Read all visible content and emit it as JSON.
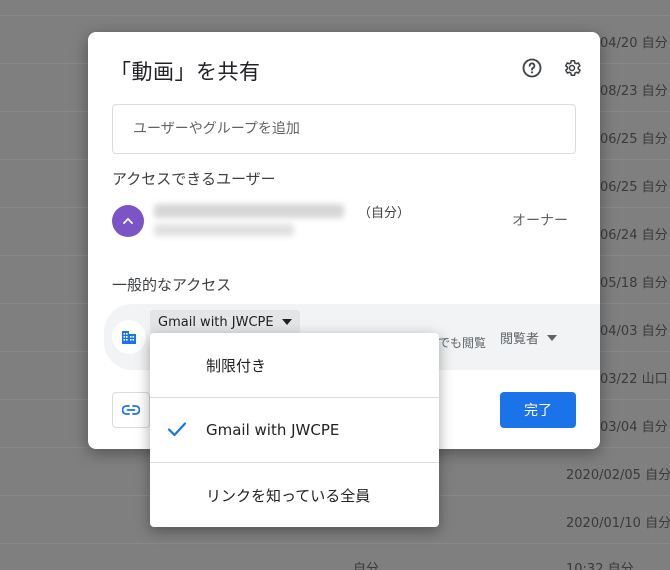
{
  "background": {
    "rows": [
      {
        "date": "04/20",
        "owner": "自分"
      },
      {
        "date": "08/23",
        "owner": "自分"
      },
      {
        "date": "06/25",
        "owner": "自分"
      },
      {
        "date": "06/25",
        "owner": "自分"
      },
      {
        "date": "06/24",
        "owner": "自分"
      },
      {
        "date": "05/18",
        "owner": "自分"
      },
      {
        "date": "04/03",
        "owner": "自分"
      },
      {
        "date": "03/22",
        "owner": "山口"
      },
      {
        "date": "03/04",
        "owner": "自分"
      },
      {
        "date": "2020/02/05",
        "owner": "自分"
      },
      {
        "date": "2020/01/10",
        "owner": "自分"
      },
      {
        "date": "10:32",
        "owner": "自分"
      }
    ],
    "middle_owner": "自分"
  },
  "dialog": {
    "title": "「動画」を共有",
    "search_placeholder": "ユーザーやグループを追加",
    "access_label": "アクセスできるユーザー",
    "user": {
      "self_tag": "（自分）",
      "role": "オーナー",
      "avatar_color": "#7b55c6"
    },
    "general_access_label": "一般的なアクセス",
    "general_access": {
      "scope": "Gmail with JWCPE",
      "description_tail": "でも閲覧",
      "role": "閲覧者"
    },
    "done_label": "完了",
    "accent_color": "#1a73e8"
  },
  "menu": {
    "items": [
      {
        "label": "制限付き",
        "checked": false
      },
      {
        "label": "Gmail with JWCPE",
        "checked": true
      },
      {
        "label": "リンクを知っている全員",
        "checked": false
      }
    ]
  }
}
